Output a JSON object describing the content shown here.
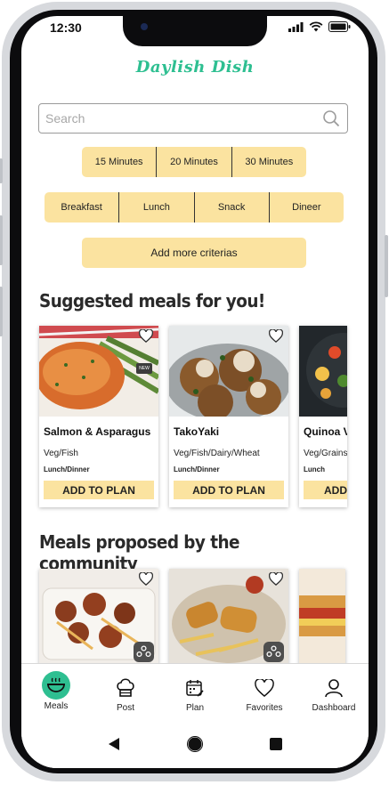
{
  "status_bar": {
    "time": "12:30"
  },
  "app": {
    "logo": "Daylish Dish"
  },
  "search": {
    "placeholder": "Search"
  },
  "time_filters": [
    "15 Minutes",
    "20 Minutes",
    "30 Minutes"
  ],
  "meal_filters": [
    "Breakfast",
    "Lunch",
    "Snack",
    "Dineer"
  ],
  "criteria_button": "Add more criterias",
  "suggested": {
    "title": "Suggested meals for you!",
    "cards": [
      {
        "name": "Salmon & Asparagus",
        "tags": "Veg/Fish",
        "time": "Lunch/Dinner",
        "badge": "NEW",
        "add": "ADD TO PLAN"
      },
      {
        "name": "TakoYaki",
        "tags": "Veg/Fish/Dairy/Wheat",
        "time": "Lunch/Dinner",
        "add": "ADD TO PLAN"
      },
      {
        "name": "Quinoa V",
        "tags": "Veg/Grains",
        "time": "Lunch",
        "add": "ADD"
      }
    ]
  },
  "community": {
    "title": "Meals proposed by the community"
  },
  "tabs": [
    {
      "label": "Meals",
      "icon": "bowl-icon",
      "active": true
    },
    {
      "label": "Post",
      "icon": "chef-hat-icon"
    },
    {
      "label": "Plan",
      "icon": "calendar-icon"
    },
    {
      "label": "Favorites",
      "icon": "heart-icon"
    },
    {
      "label": "Dashboard",
      "icon": "user-icon"
    }
  ],
  "colors": {
    "accent": "#2ebf91",
    "chip": "#fbe3a0"
  }
}
